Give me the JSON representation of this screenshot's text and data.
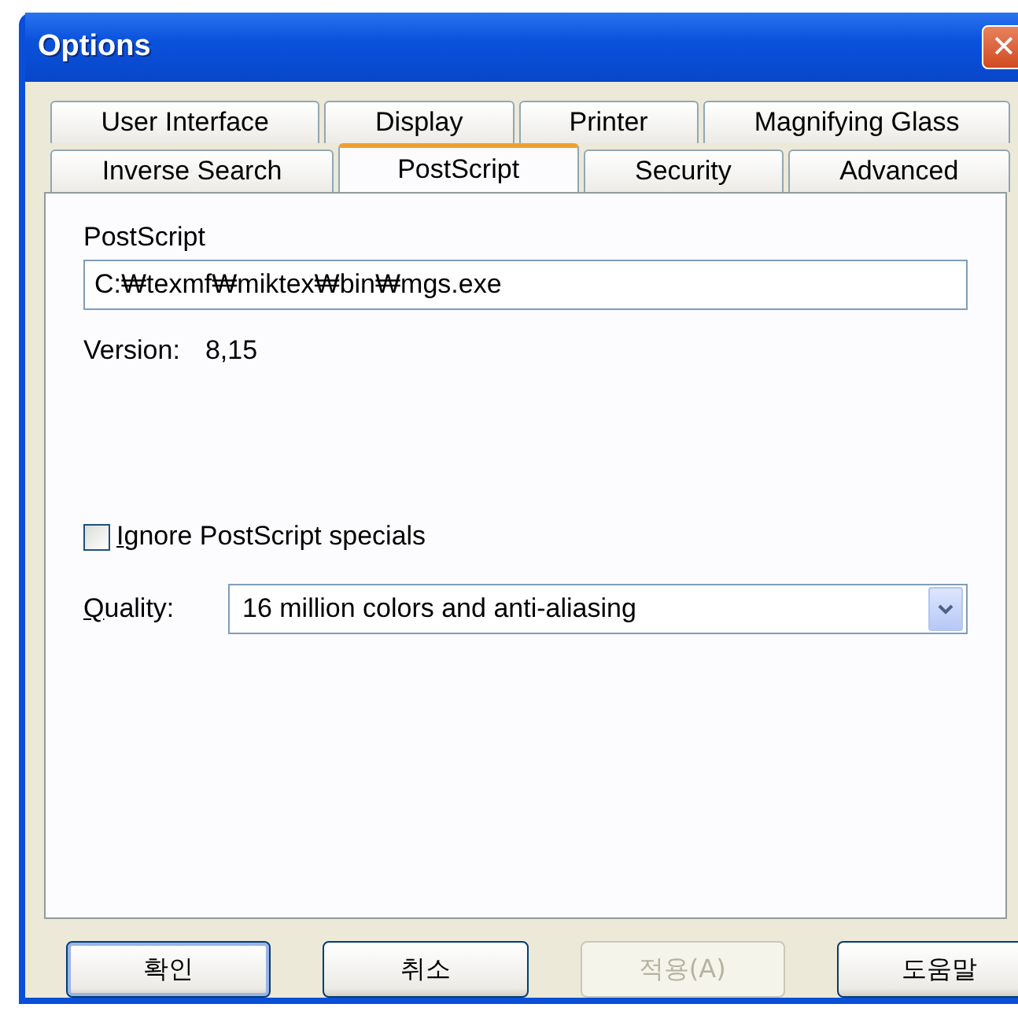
{
  "window": {
    "title": "Options",
    "close": "✕"
  },
  "tab_rows": [
    {
      "tabs": [
        {
          "label": "User Interface",
          "selected": false
        },
        {
          "label": "Display",
          "selected": false
        },
        {
          "label": "Printer",
          "selected": false
        },
        {
          "label": "Magnifying Glass",
          "selected": false
        }
      ]
    },
    {
      "tabs": [
        {
          "label": "Inverse Search",
          "selected": false
        },
        {
          "label": "PostScript",
          "selected": true
        },
        {
          "label": "Security",
          "selected": false
        },
        {
          "label": "Advanced",
          "selected": false
        }
      ]
    }
  ],
  "postscript": {
    "label": "PostScript",
    "value": "C:₩texmf₩miktex₩bin₩mgs.exe"
  },
  "version": {
    "label": "Version:",
    "value": "8,15"
  },
  "ignore_specials": {
    "label": "Ignore PostScript specials",
    "checked": false
  },
  "quality": {
    "label": "Quality:",
    "value": "16 million colors and anti-aliasing"
  },
  "buttons": [
    {
      "label": "확인",
      "default": true,
      "disabled": false
    },
    {
      "label": "취소",
      "default": false,
      "disabled": false
    },
    {
      "label": "적용(A)",
      "default": false,
      "disabled": true
    },
    {
      "label": "도움말",
      "default": false,
      "disabled": false
    }
  ]
}
